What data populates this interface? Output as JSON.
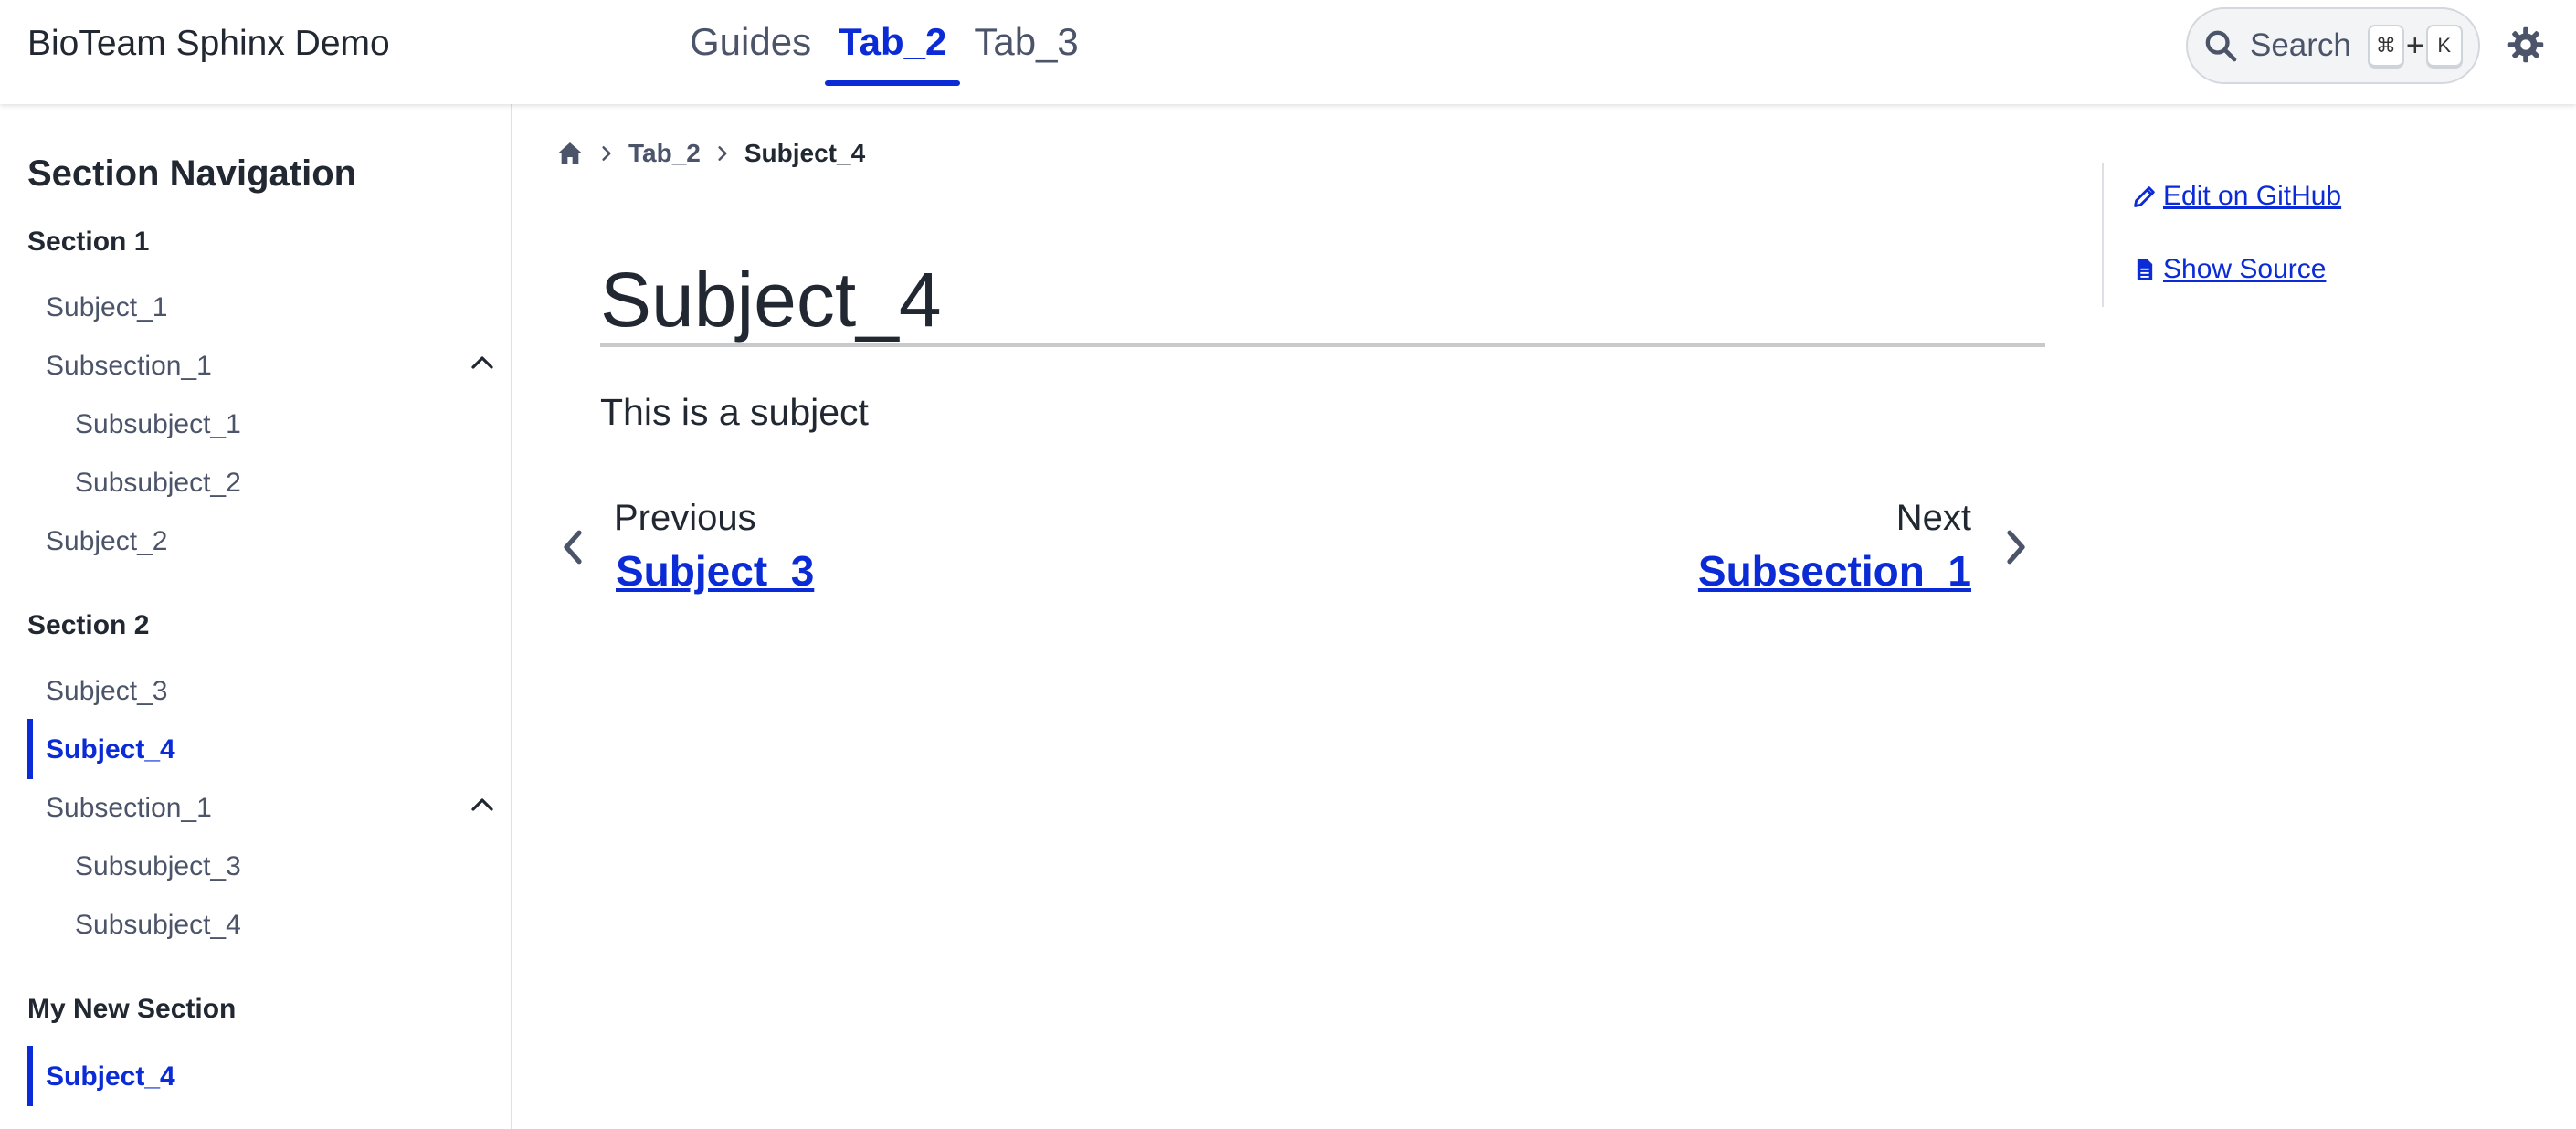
{
  "header": {
    "brand": "BioTeam Sphinx Demo",
    "tabs": [
      {
        "label": "Guides"
      },
      {
        "label": "Tab_2"
      },
      {
        "label": "Tab_3"
      }
    ],
    "search": {
      "label": "Search",
      "key1": "⌘",
      "plus": "+",
      "key2": "K"
    }
  },
  "sidebar": {
    "title": "Section Navigation",
    "section1": {
      "heading": "Section 1",
      "items": [
        "Subject_1",
        "Subsection_1",
        "Subsubject_1",
        "Subsubject_2",
        "Subject_2"
      ]
    },
    "section2": {
      "heading": "Section 2",
      "items": [
        "Subject_3",
        "Subject_4",
        "Subsection_1",
        "Subsubject_3",
        "Subsubject_4"
      ]
    },
    "section3": {
      "heading": "My New Section",
      "items": [
        "Subject_4"
      ]
    }
  },
  "breadcrumb": {
    "items": [
      "Tab_2",
      "Subject_4"
    ]
  },
  "main": {
    "title": "Subject_4",
    "lead": "This is a subject",
    "prev": {
      "label": "Previous",
      "link": "Subject_3"
    },
    "next": {
      "label": "Next",
      "link": "Subsection_1"
    }
  },
  "aside": {
    "edit": "Edit on GitHub",
    "source": "Show Source"
  },
  "colors": {
    "accent": "#0a2bd6",
    "text": "#222832",
    "muted": "#4b5468"
  }
}
